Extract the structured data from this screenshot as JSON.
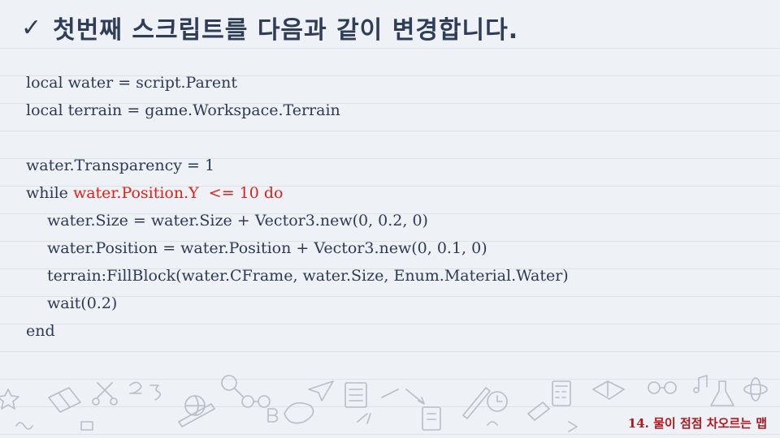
{
  "title": {
    "check_icon": "check-icon",
    "text": "첫번째 스크립트를 다음과 같이 변경합니다."
  },
  "code": {
    "line1": "local water = script.Parent",
    "line2": "local terrain = game.Workspace.Terrain",
    "line3": "",
    "line4": "water.Transparency = 1",
    "line5_kw": "while ",
    "line5_hl": "water.Position.Y  <= 10 do",
    "line6": "water.Size = water.Size + Vector3.new(0, 0.2, 0)",
    "line7": "water.Position = water.Position + Vector3.new(0, 0.1, 0)",
    "line8": "terrain:FillBlock(water.CFrame, water.Size, Enum.Material.Water)",
    "line9": "wait(0.2)",
    "line10": "end"
  },
  "footer": {
    "text": "14. 물이 점점 차오르는 맵"
  },
  "colors": {
    "text": "#2e3a55",
    "highlight": "#e0201a",
    "footer": "#b3161b",
    "doodle": "#b7bdc9"
  }
}
